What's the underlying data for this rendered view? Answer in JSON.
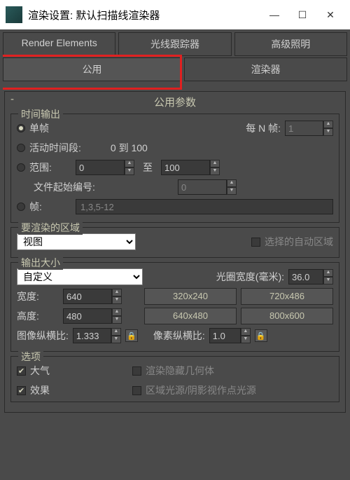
{
  "window": {
    "title": "渲染设置: 默认扫描线渲染器"
  },
  "tabs": {
    "row1": [
      "Render Elements",
      "光线跟踪器",
      "高级照明"
    ],
    "row2": [
      "公用",
      "渲染器"
    ]
  },
  "panel_title": "公用参数",
  "time_output": {
    "legend": "时间输出",
    "single": "单帧",
    "every_n_label": "每 N 帧:",
    "every_n_value": "1",
    "active_segment": "活动时间段:",
    "active_range": "0 到 100",
    "range": "范围:",
    "range_from": "0",
    "range_to_label": "至",
    "range_to": "100",
    "file_start_label": "文件起始编号:",
    "file_start": "0",
    "frames": "帧:",
    "frames_value": "1,3,5-12"
  },
  "area": {
    "legend": "要渲染的区域",
    "dropdown": "视图",
    "auto_region": "选择的自动区域"
  },
  "output_size": {
    "legend": "输出大小",
    "dropdown": "自定义",
    "aperture_label": "光圈宽度(毫米):",
    "aperture": "36.0",
    "width_label": "宽度:",
    "width": "640",
    "height_label": "高度:",
    "height": "480",
    "presets": [
      "320x240",
      "720x486",
      "640x480",
      "800x600"
    ],
    "img_aspect_label": "图像纵横比:",
    "img_aspect": "1.333",
    "pix_aspect_label": "像素纵横比:",
    "pix_aspect": "1.0"
  },
  "options": {
    "legend": "选项",
    "atmosphere": "大气",
    "render_hidden": "渲染隐藏几何体",
    "effects": "效果",
    "area_lights": "区域光源/阴影视作点光源"
  }
}
